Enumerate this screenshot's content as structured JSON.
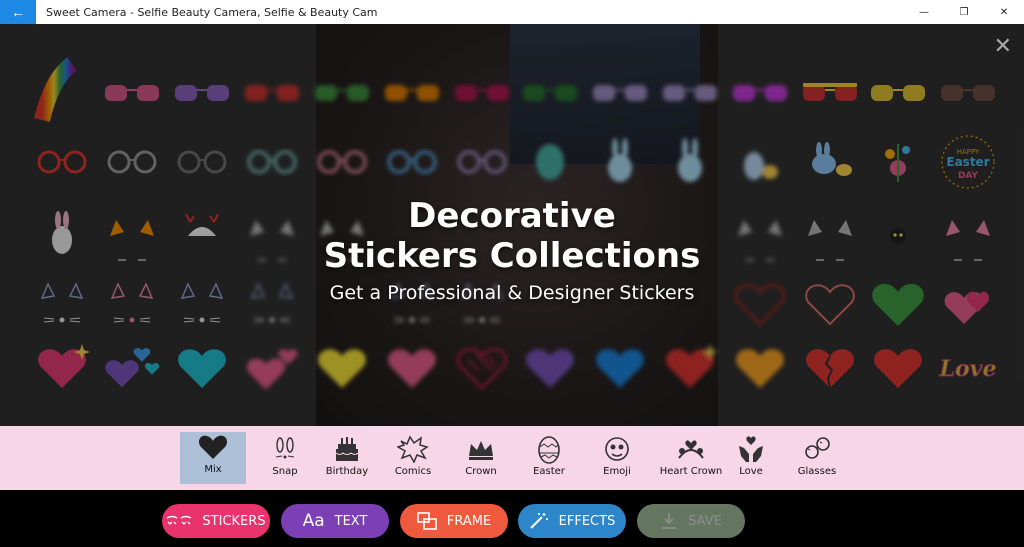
{
  "window": {
    "title": "Sweet Camera - Selfie Beauty Camera, Selfie & Beauty Cam",
    "back_glyph": "←",
    "minimize_glyph": "—",
    "restore_glyph": "❐",
    "close_glyph": "✕"
  },
  "overlay": {
    "close_glyph": "✕",
    "headline_line1": "Decorative",
    "headline_line2": "Stickers Collections",
    "subline": "Get a Professional & Designer Stickers"
  },
  "stickers": {
    "row1": [
      "rainbow",
      "pink-glasses",
      "purple-glasses",
      "red-glasses",
      "green-glasses",
      "orange-glasses",
      "magenta-glasses",
      "green-glasses-2",
      "lilac-glasses",
      "lilac-glasses-2",
      "magenta-glasses-2",
      "red-yellow-sunglasses",
      "yellow-glasses",
      "brown-glasses"
    ],
    "row2": [
      "red-frame-glasses",
      "grey-glasses",
      "dark-glasses",
      "teal-glasses",
      "pink-glasses-2",
      "blue-glasses",
      "purple-glasses-2",
      "easter-egg",
      "easter-bunny",
      "easter-bunny-2",
      "easter-chick",
      "easter-bunny-chick",
      "easter-flowers",
      "happy-easter-day"
    ],
    "row2_badge": {
      "line1": "HAPPY",
      "line2": "Easter",
      "line3": "DAY"
    },
    "hearts": [
      "pink-heart",
      "purple-hearts",
      "teal-heart",
      "pink-hearts-small",
      "yellow-heart",
      "pink-heart-2",
      "scribble-heart",
      "purple-heart",
      "blue-heart",
      "red-heart-sparkle",
      "orange-heart",
      "broken-heart",
      "red-heart",
      "love-text"
    ],
    "love_text": "Love"
  },
  "categories": [
    {
      "id": "mix",
      "label": "Mix",
      "icon": "heart-icon",
      "active": true
    },
    {
      "id": "snap",
      "label": "Snap",
      "icon": "bunny-ears-icon",
      "active": false
    },
    {
      "id": "birthday",
      "label": "Birthday",
      "icon": "cake-icon",
      "active": false
    },
    {
      "id": "comics",
      "label": "Comics",
      "icon": "comic-bubble-icon",
      "active": false
    },
    {
      "id": "crown",
      "label": "Crown",
      "icon": "crown-icon",
      "active": false
    },
    {
      "id": "easter",
      "label": "Easter",
      "icon": "easter-egg-icon",
      "active": false
    },
    {
      "id": "emoji",
      "label": "Emoji",
      "icon": "emoji-icon",
      "active": false
    },
    {
      "id": "heart-crown",
      "label": "Heart Crown",
      "icon": "heart-crown-icon",
      "active": false
    },
    {
      "id": "love",
      "label": "Love",
      "icon": "hands-heart-icon",
      "active": false
    },
    {
      "id": "glasses",
      "label": "Glasses",
      "icon": "glasses-icon",
      "active": false
    }
  ],
  "toolbar": {
    "stickers": {
      "label": "STICKERS",
      "color": "#e8336e"
    },
    "text": {
      "label": "TEXT",
      "icon_text": "Aa",
      "color": "#7c3fb5"
    },
    "frame": {
      "label": "FRAME",
      "color": "#ef5a3e"
    },
    "effects": {
      "label": "EFFECTS",
      "color": "#2c86c9"
    },
    "save": {
      "label": "SAVE",
      "color": "#b8d8b0"
    }
  }
}
